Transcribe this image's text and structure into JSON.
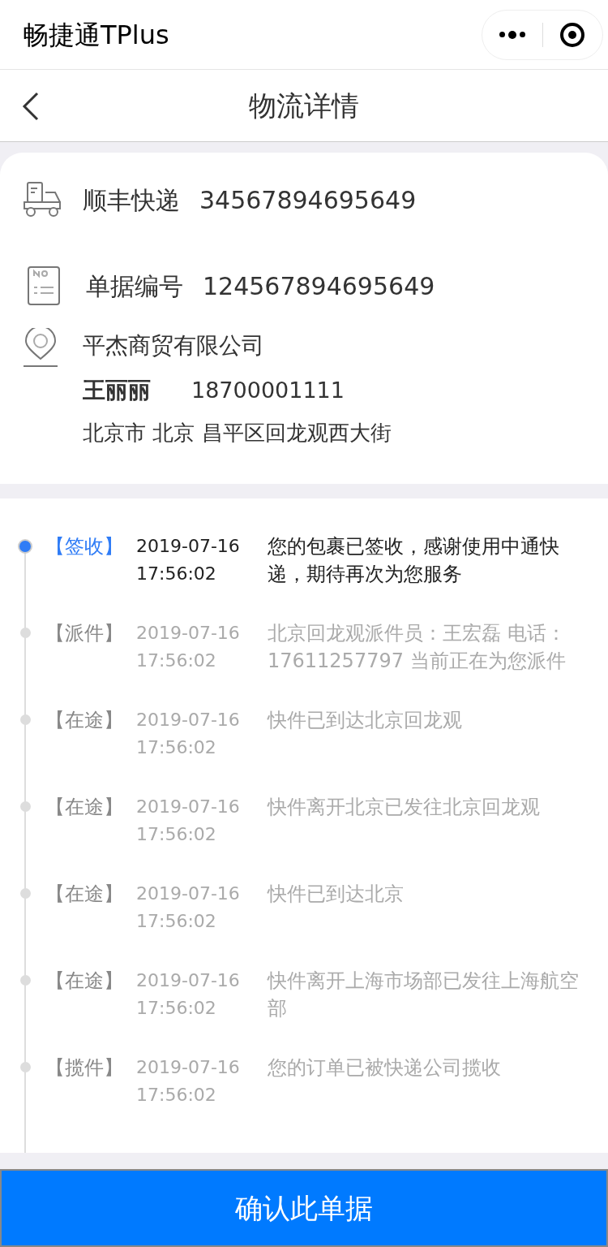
{
  "app_bar": {
    "title": "畅捷通TPlus"
  },
  "nav": {
    "title": "物流详情"
  },
  "shipment": {
    "carrier": "顺丰快递",
    "tracking_number": "34567894695649",
    "doc_label": "单据编号",
    "doc_number": "124567894695649",
    "company": "平杰商贸有限公司",
    "contact_name": "王丽丽",
    "phone": "18700001111",
    "address": "北京市 北京 昌平区回龙观西大街"
  },
  "timeline": [
    {
      "status": "【签收】",
      "date": "2019-07-16",
      "time": "17:56:02",
      "text": "您的包裹已签收，感谢使用中通快递，期待再次为您服务",
      "current": true
    },
    {
      "status": "【派件】",
      "date": "2019-07-16",
      "time": "17:56:02",
      "text": "北京回龙观派件员：王宏磊 电话：17611257797 当前正在为您派件",
      "current": false
    },
    {
      "status": "【在途】",
      "date": "2019-07-16",
      "time": "17:56:02",
      "text": "快件已到达北京回龙观",
      "current": false
    },
    {
      "status": "【在途】",
      "date": "2019-07-16",
      "time": "17:56:02",
      "text": "快件离开北京已发往北京回龙观",
      "current": false
    },
    {
      "status": "【在途】",
      "date": "2019-07-16",
      "time": "17:56:02",
      "text": "快件已到达北京",
      "current": false
    },
    {
      "status": "【在途】",
      "date": "2019-07-16",
      "time": "17:56:02",
      "text": "快件离开上海市场部已发往上海航空部",
      "current": false
    },
    {
      "status": "【揽件】",
      "date": "2019-07-16",
      "time": "17:56:02",
      "text": "您的订单已被快递公司揽收",
      "current": false
    }
  ],
  "confirm_button": "确认此单据"
}
